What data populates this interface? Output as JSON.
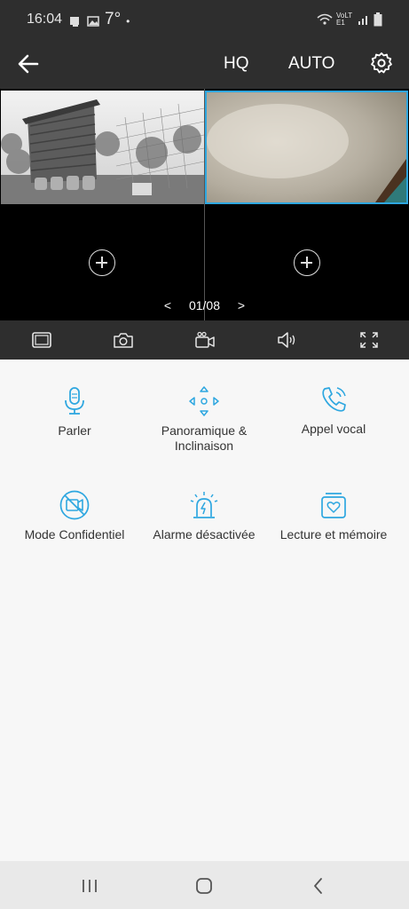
{
  "status_bar": {
    "time": "16:04",
    "temperature": "7°",
    "dot": "•",
    "network": "VoLTE1",
    "icons": [
      "notification-icon",
      "image-icon",
      "wifi-icon",
      "signal-icon",
      "battery-icon"
    ]
  },
  "toolbar": {
    "hq_label": "HQ",
    "auto_label": "AUTO",
    "icons": [
      "back-arrow-icon",
      "gear-icon"
    ]
  },
  "camera_grid": {
    "page_indicator": "01/08",
    "prev": "<",
    "next": ">",
    "cameras": [
      {
        "name": "camera-feed-garden",
        "selected": false
      },
      {
        "name": "camera-feed-indoor",
        "selected": true
      }
    ],
    "empty_slots": 2
  },
  "control_bar": {
    "icons": [
      "layout-icon",
      "camera-snapshot-icon",
      "video-record-icon",
      "speaker-icon",
      "fullscreen-icon"
    ]
  },
  "features": [
    {
      "label": "Parler",
      "icon": "microphone-icon"
    },
    {
      "label": "Panoramique & Inclinaison",
      "icon": "pan-tilt-icon"
    },
    {
      "label": "Appel vocal",
      "icon": "phone-call-icon"
    },
    {
      "label": "Mode Confidentiel",
      "icon": "privacy-camera-off-icon"
    },
    {
      "label": "Alarme désactivée",
      "icon": "siren-icon"
    },
    {
      "label": "Lecture et mémoire",
      "icon": "playback-memory-icon"
    }
  ],
  "nav_bar": {
    "icons": [
      "recents-icon",
      "home-icon",
      "back-icon"
    ]
  },
  "colors": {
    "accent": "#2ea7e0",
    "dark_bar": "#2e2e2e",
    "panel_bg": "#f7f7f7"
  }
}
